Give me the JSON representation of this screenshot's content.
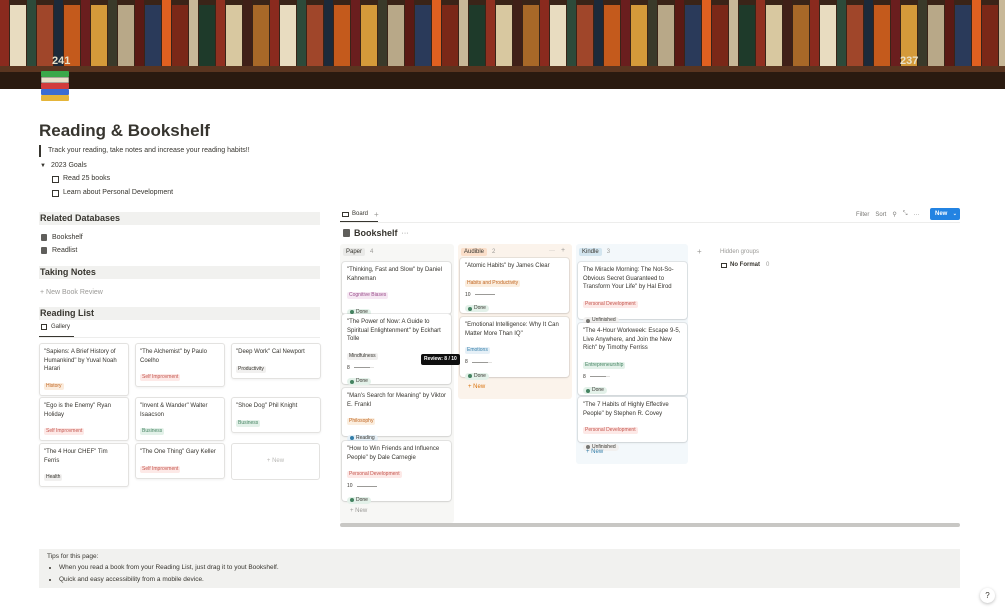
{
  "banner": {
    "shelf_left": "241",
    "shelf_right": "237"
  },
  "page": {
    "title": "Reading & Bookshelf",
    "quote": "Track your reading, take notes and increase your reading habits!!"
  },
  "goals": {
    "toggle_label": "2023 Goals",
    "todos": [
      "Read 25 books",
      "Learn about Personal Development"
    ]
  },
  "related": {
    "heading": "Related Databases",
    "links": [
      "Bookshelf",
      "Readlist"
    ]
  },
  "notes": {
    "heading": "Taking Notes",
    "new_label": "+ New Book Review"
  },
  "reading_list": {
    "heading": "Reading List",
    "tab": "Gallery",
    "cards": [
      {
        "title": "\"Sapiens: A Brief History of Humankind\" by Yuval Noah Harari",
        "tag": "History"
      },
      {
        "title": "\"The Alchemist\" by Paulo Coelho",
        "tag": "Self Improvment"
      },
      {
        "title": "\"Deep Work\" Cal Newport",
        "tag": "Productivity"
      },
      {
        "title": "\"Ego is the Enemy\" Ryan Holiday",
        "tag": "Self Improvment"
      },
      {
        "title": "\"Invent & Wander\" Walter Isaacson",
        "tag": "Business"
      },
      {
        "title": "\"Shoe Dog\" Phil Knight",
        "tag": "Business"
      },
      {
        "title": "\"The 4 Hour CHEF\" Tim Ferris",
        "tag": "Health"
      },
      {
        "title": "\"The One Thing\" Gary Keller",
        "tag": "Self Improvment"
      }
    ],
    "new_label": "+ New"
  },
  "board": {
    "tab": "Board",
    "add": "+",
    "tools": {
      "filter": "Filter",
      "sort": "Sort",
      "search_glyph": "⚲",
      "expand_glyph": "⤡",
      "more_glyph": "···"
    },
    "new_button": "New",
    "view_title": "Bookshelf",
    "view_more": "···",
    "hidden_groups": "Hidden groups",
    "no_format": "No Format",
    "no_format_count": "0",
    "tooltip": "Review: 8 / 10",
    "col_add": "+",
    "col_new": "+ New",
    "columns": [
      {
        "name": "Paper",
        "count": "4",
        "cards": [
          {
            "title": "\"Thinking, Fast and Slow\" by Daniel Kahneman",
            "tag": "Cognitive Biases",
            "status": "Done"
          },
          {
            "title": "\"The Power of Now: A Guide to Spiritual Enlightenment\" by Eckhart Tolle",
            "tag": "Mindfulness",
            "rating": "8",
            "rating_fill": 0.8,
            "status": "Done"
          },
          {
            "title": "\"Man's Search for Meaning\" by Viktor E. Frankl",
            "tag": "Philosophy",
            "status": "Reading"
          },
          {
            "title": "\"How to Win Friends and Influence People\" by Dale Carnegie",
            "tag": "Personal Development",
            "rating": "10",
            "rating_fill": 1.0,
            "status": "Done"
          }
        ]
      },
      {
        "name": "Audible",
        "count": "2",
        "head_more": "···",
        "head_add": "+",
        "cards": [
          {
            "title": "\"Atomic Habits\" by James Clear",
            "tag": "Habits and Productivity",
            "rating": "10",
            "rating_fill": 1.0,
            "status": "Done"
          },
          {
            "title": "\"Emotional Intelligence: Why It Can Matter More Than IQ\"",
            "tag": "Emotions",
            "rating": "8",
            "rating_fill": 0.8,
            "status": "Done"
          }
        ]
      },
      {
        "name": "Kindle",
        "count": "3",
        "cards": [
          {
            "title": "The Miracle Morning: The Not-So-Obvious Secret Guaranteed to Transform Your Life\" by Hal Elrod",
            "tag": "Personal Development",
            "status": "Unfinished"
          },
          {
            "title": "\"The 4-Hour Workweek: Escape 9-5, Live Anywhere, and Join the New Rich\" by Timothy Ferriss",
            "tag": "Entrepreneurship",
            "rating": "8",
            "rating_fill": 0.8,
            "status": "Done"
          },
          {
            "title": "\"The 7 Habits of Highly Effective People\" by Stephen R. Covey",
            "tag": "Personal Development",
            "status": "Unfinished"
          }
        ]
      }
    ]
  },
  "tips": {
    "heading": "Tips for this page:",
    "items": [
      "When you read a book from your Reading List, just drag it to yout Bookshelf.",
      "Quick and easy accessibility from a mobile device."
    ]
  },
  "help": "?"
}
